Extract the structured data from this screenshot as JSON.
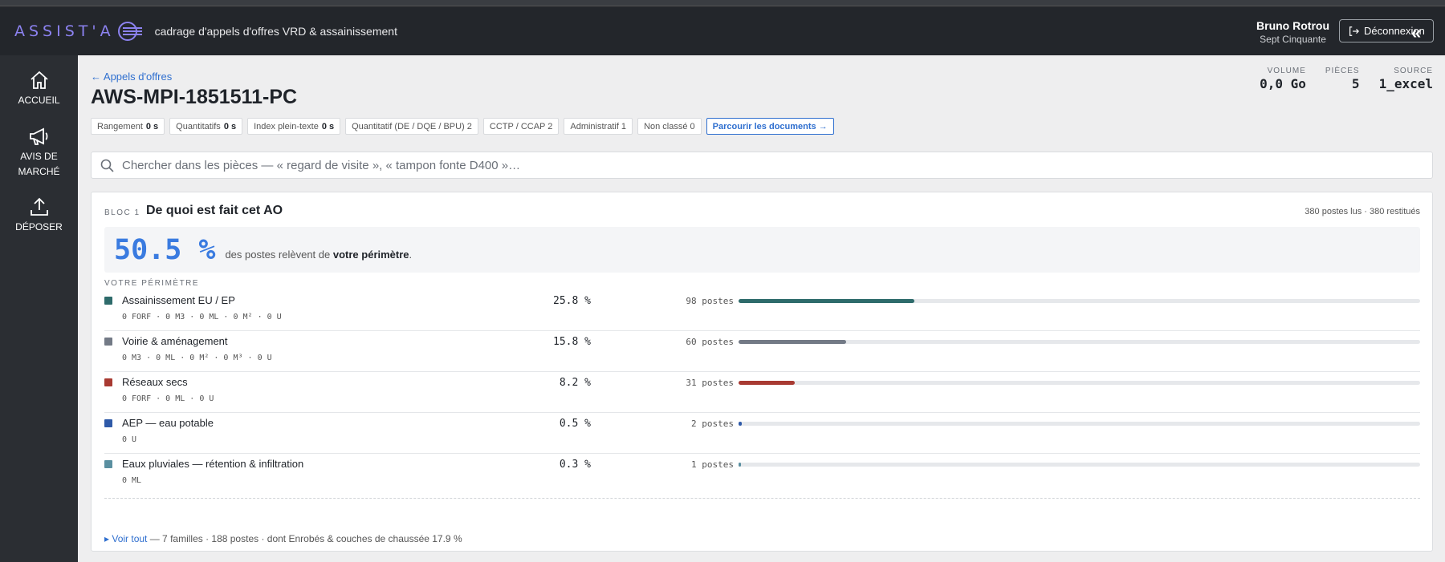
{
  "header": {
    "logo_text": "ASSIST'A",
    "subtitle": "cadrage d'appels d'offres VRD & assainissement",
    "user_name": "Bruno Rotrou",
    "user_org": "Sept Cinquante",
    "logout_label": "Déconnexion",
    "collapse_glyph": "«"
  },
  "sidebar": {
    "items": [
      {
        "label": "ACCUEIL",
        "icon": "home-icon"
      },
      {
        "label": "AVIS DE MARCHÉ",
        "icon": "megaphone-icon"
      },
      {
        "label": "DÉPOSER",
        "icon": "upload-icon"
      }
    ]
  },
  "page": {
    "back_link": "← Appels d'offres",
    "title": "AWS-MPI-1851511-PC",
    "stats": [
      {
        "label": "VOLUME",
        "value": "0,0 Go"
      },
      {
        "label": "PIÈCES",
        "value": "5"
      },
      {
        "label": "SOURCE",
        "value": "1_excel"
      }
    ],
    "chips": [
      {
        "label": "Rangement",
        "value": "0 s"
      },
      {
        "label": "Quantitatifs",
        "value": "0 s"
      },
      {
        "label": "Index plein-texte",
        "value": "0 s"
      },
      {
        "label": "Quantitatif (DE / DQE / BPU) 2",
        "value": ""
      },
      {
        "label": "CCTP / CCAP 2",
        "value": ""
      },
      {
        "label": "Administratif 1",
        "value": ""
      },
      {
        "label": "Non classé 0",
        "value": ""
      }
    ],
    "browse_button": "Parcourir les documents →",
    "search_placeholder": "Chercher dans les pièces — « regard de visite », « tampon fonte D400 »…"
  },
  "bloc": {
    "label": "BLOC 1",
    "title": "De quoi est fait cet AO",
    "meta": "380 postes lus · 380 restitués",
    "pct": "50.5 %",
    "pct_text_before": "des postes relèvent de",
    "pct_text_bold": "votre périmètre",
    "pct_text_after": ".",
    "perimetre_title": "VOTRE PÉRIMÈTRE",
    "rows": [
      {
        "label": "Assainissement EU / EP",
        "units": "0 FORF · 0 M3 · 0 ML · 0 M² · 0 U",
        "pct": "25.8 %",
        "count": "98 postes",
        "share": 25.8,
        "color": "#2e6b6b"
      },
      {
        "label": "Voirie & aménagement",
        "units": "0 M3 · 0 ML · 0 M² · 0 M³ · 0 U",
        "pct": "15.8 %",
        "count": "60 postes",
        "share": 15.8,
        "color": "#737a86"
      },
      {
        "label": "Réseaux secs",
        "units": "0 FORF · 0 ML · 0 U",
        "pct": "8.2 %",
        "count": "31 postes",
        "share": 8.2,
        "color": "#a83a32"
      },
      {
        "label": "AEP — eau potable",
        "units": "0 U",
        "pct": "0.5 %",
        "count": "2 postes",
        "share": 0.5,
        "color": "#2f5aa8"
      },
      {
        "label": "Eaux pluviales — rétention & infiltration",
        "units": "0 ML",
        "pct": "0.3 %",
        "count": "1 postes",
        "share": 0.3,
        "color": "#5a8fa0"
      }
    ],
    "footer_link": "▸ Voir tout",
    "footer_text": " — 7 familles · 188 postes · dont Enrobés & couches de chaussée 17.9 %"
  }
}
